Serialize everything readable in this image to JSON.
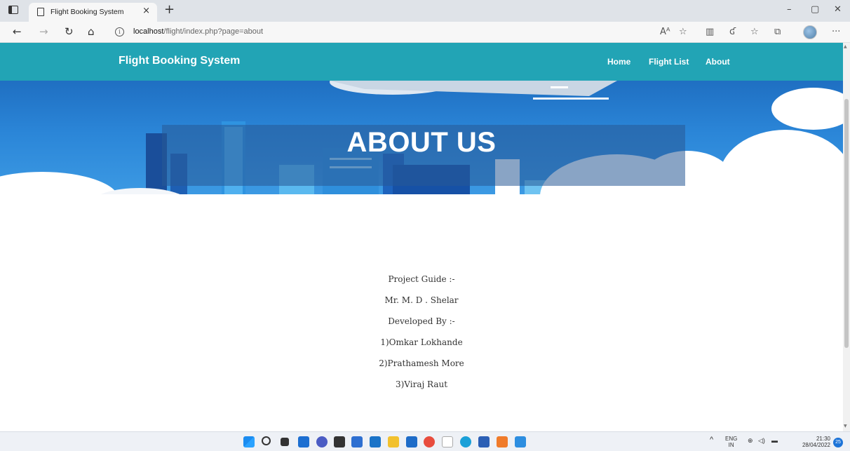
{
  "browser": {
    "tab_title": "Flight Booking System",
    "tab_close": "×",
    "new_tab": "+",
    "url_host": "localhost",
    "url_path": "/flight/index.php?page=about",
    "window_controls": {
      "minimize": "–",
      "maximize": "▢",
      "close": "✕"
    }
  },
  "site": {
    "brand": "Flight Booking System",
    "nav": [
      {
        "label": "Home"
      },
      {
        "label": "Flight List"
      },
      {
        "label": "About"
      }
    ],
    "hero_title": "ABOUT US",
    "credits": [
      "Project Guide :-",
      "Mr. M. D . Shelar",
      "Developed By :-",
      "1)Omkar Lokhande",
      "2)Prathamesh More",
      "3)Viraj Raut"
    ]
  },
  "taskbar": {
    "lang_top": "ENG",
    "lang_bottom": "IN",
    "time": "21:30",
    "date": "28/04/2022",
    "notification_count": "25",
    "icons": [
      "windows-start-icon",
      "search-icon",
      "task-view-icon",
      "widgets-icon",
      "chat-icon",
      "store-icon",
      "dropbox-icon",
      "app-icon",
      "file-explorer-icon",
      "mail-icon",
      "chrome-icon",
      "app-icon-2",
      "edge-icon",
      "word-icon",
      "xampp-icon",
      "vscode-icon"
    ],
    "colors": {
      "accent": "#22a4b5",
      "hero": "#2b86d8"
    }
  }
}
